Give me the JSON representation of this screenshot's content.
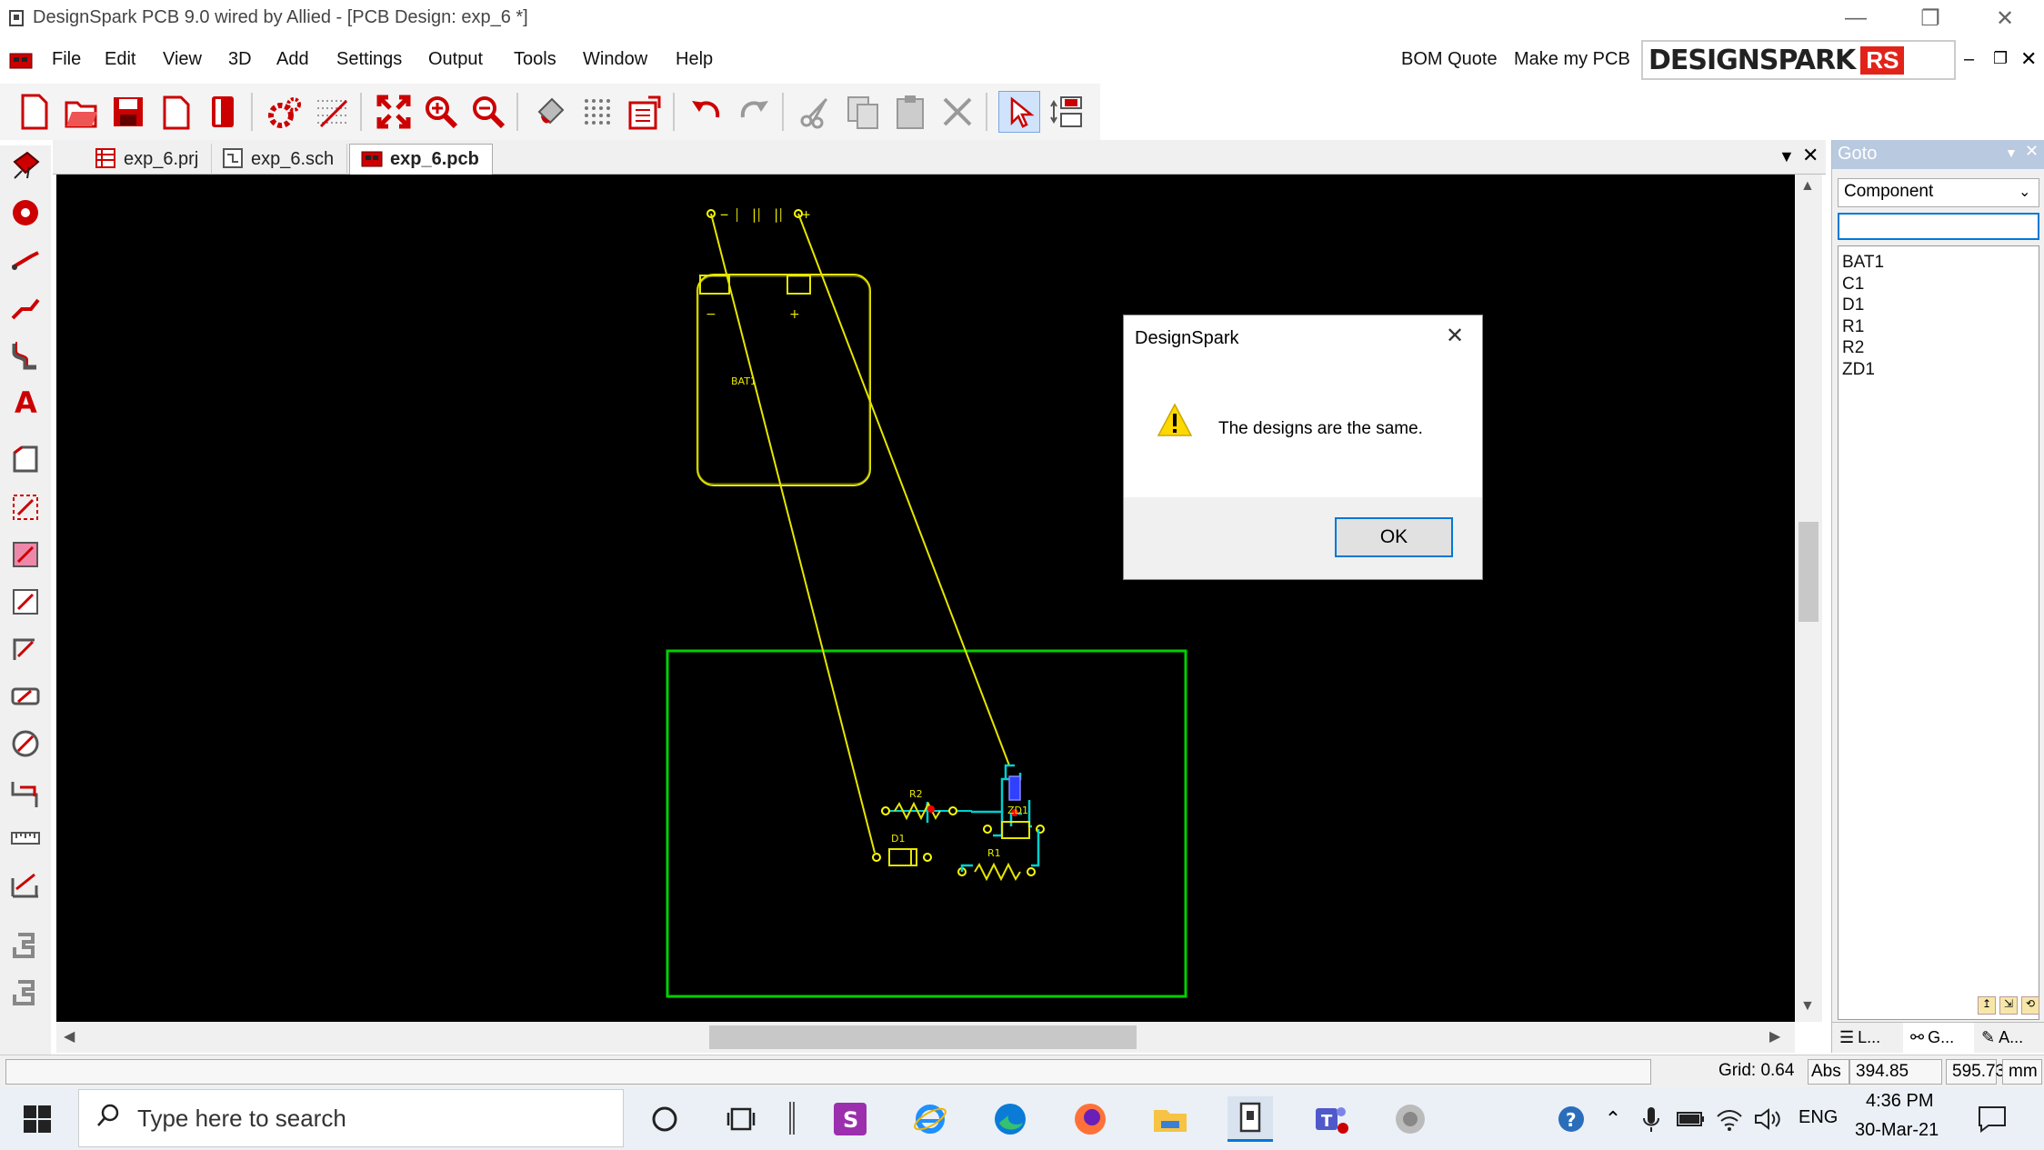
{
  "window": {
    "title": "DesignSpark PCB 9.0 wired by Allied - [PCB Design: exp_6 *]"
  },
  "menu": {
    "items": [
      "File",
      "Edit",
      "View",
      "3D",
      "Add",
      "Settings",
      "Output",
      "Tools",
      "Window",
      "Help"
    ],
    "bom_quote": "BOM Quote",
    "make_pcb": "Make my PCB",
    "brand": "DESIGNSPARK",
    "brand_badge": "RS"
  },
  "tabs": [
    {
      "label": "exp_6.prj",
      "icon": "project-icon"
    },
    {
      "label": "exp_6.sch",
      "icon": "schematic-icon"
    },
    {
      "label": "exp_6.pcb",
      "icon": "pcb-icon",
      "active": true
    }
  ],
  "canvas": {
    "battery_label": "BAT1",
    "battery_minus": "−",
    "battery_plus": "+",
    "battery_symbol": "− ⎸|⎸|⎸ +",
    "r2_label": "R2",
    "d1_label": "D1",
    "r1_label": "R1",
    "zd1_label": "ZD1",
    "colors": {
      "background": "#000000",
      "ratsnest": "#e6e600",
      "board_outline": "#00d000",
      "track": "#00d0d0",
      "pad": "#ffff00"
    }
  },
  "goto": {
    "title": "Goto",
    "filter": "Component",
    "search_value": "",
    "items": [
      "BAT1",
      "C1",
      "D1",
      "R1",
      "R2",
      "ZD1"
    ],
    "bottom_tabs": [
      "L...",
      "G...",
      "A..."
    ]
  },
  "dialog": {
    "title": "DesignSpark",
    "message": "The designs are the same.",
    "ok": "OK",
    "icon": "warning-icon"
  },
  "status": {
    "grid": "Grid: 0.64",
    "abs": "Abs",
    "x": "394.85",
    "y": "595.73",
    "units": "mm"
  },
  "taskbar": {
    "search_placeholder": "Type here to search",
    "language": "ENG",
    "time": "4:36 PM",
    "date": "30-Mar-21"
  }
}
